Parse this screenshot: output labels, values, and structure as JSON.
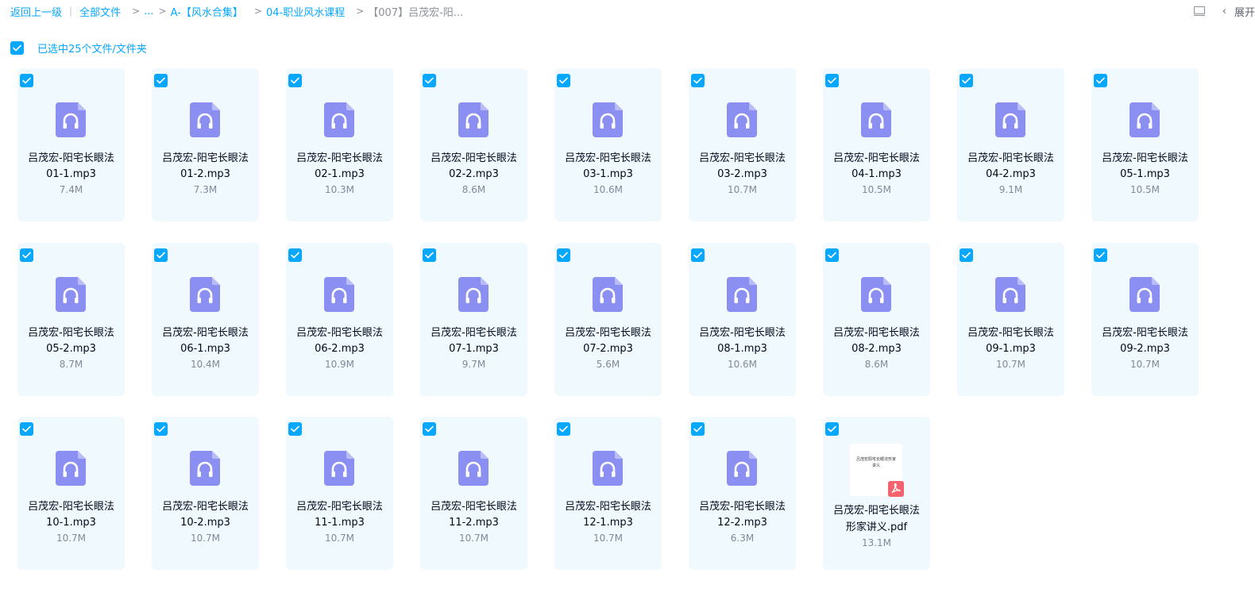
{
  "breadcrumb": {
    "back": "返回上一级",
    "all_files": "全部文件",
    "ellipsis": "...",
    "folder_a": "A-【风水合集】",
    "folder_04": "04-职业风水课程",
    "current": "【007】吕茂宏-阳..."
  },
  "top_right": {
    "expand_label": "展开"
  },
  "selection": {
    "label": "已选中25个文件/文件夹"
  },
  "colors": {
    "accent": "#06a7ff",
    "card_bg": "#f0f9fe",
    "audio_icon": "#8b8ff2",
    "pdf_badge": "#f5646e"
  },
  "files": [
    {
      "line1": "吕茂宏-阳宅长眼法",
      "line2": "01-1.mp3",
      "size": "7.4M",
      "type": "audio"
    },
    {
      "line1": "吕茂宏-阳宅长眼法",
      "line2": "01-2.mp3",
      "size": "7.3M",
      "type": "audio"
    },
    {
      "line1": "吕茂宏-阳宅长眼法",
      "line2": "02-1.mp3",
      "size": "10.3M",
      "type": "audio"
    },
    {
      "line1": "吕茂宏-阳宅长眼法",
      "line2": "02-2.mp3",
      "size": "8.6M",
      "type": "audio"
    },
    {
      "line1": "吕茂宏-阳宅长眼法",
      "line2": "03-1.mp3",
      "size": "10.6M",
      "type": "audio"
    },
    {
      "line1": "吕茂宏-阳宅长眼法",
      "line2": "03-2.mp3",
      "size": "10.7M",
      "type": "audio"
    },
    {
      "line1": "吕茂宏-阳宅长眼法",
      "line2": "04-1.mp3",
      "size": "10.5M",
      "type": "audio"
    },
    {
      "line1": "吕茂宏-阳宅长眼法",
      "line2": "04-2.mp3",
      "size": "9.1M",
      "type": "audio"
    },
    {
      "line1": "吕茂宏-阳宅长眼法",
      "line2": "05-1.mp3",
      "size": "10.5M",
      "type": "audio"
    },
    {
      "line1": "吕茂宏-阳宅长眼法",
      "line2": "05-2.mp3",
      "size": "8.7M",
      "type": "audio"
    },
    {
      "line1": "吕茂宏-阳宅长眼法",
      "line2": "06-1.mp3",
      "size": "10.4M",
      "type": "audio"
    },
    {
      "line1": "吕茂宏-阳宅长眼法",
      "line2": "06-2.mp3",
      "size": "10.9M",
      "type": "audio"
    },
    {
      "line1": "吕茂宏-阳宅长眼法",
      "line2": "07-1.mp3",
      "size": "9.7M",
      "type": "audio"
    },
    {
      "line1": "吕茂宏-阳宅长眼法",
      "line2": "07-2.mp3",
      "size": "5.6M",
      "type": "audio"
    },
    {
      "line1": "吕茂宏-阳宅长眼法",
      "line2": "08-1.mp3",
      "size": "10.6M",
      "type": "audio"
    },
    {
      "line1": "吕茂宏-阳宅长眼法",
      "line2": "08-2.mp3",
      "size": "8.6M",
      "type": "audio"
    },
    {
      "line1": "吕茂宏-阳宅长眼法",
      "line2": "09-1.mp3",
      "size": "10.7M",
      "type": "audio"
    },
    {
      "line1": "吕茂宏-阳宅长眼法",
      "line2": "09-2.mp3",
      "size": "10.7M",
      "type": "audio"
    },
    {
      "line1": "吕茂宏-阳宅长眼法",
      "line2": "10-1.mp3",
      "size": "10.7M",
      "type": "audio"
    },
    {
      "line1": "吕茂宏-阳宅长眼法",
      "line2": "10-2.mp3",
      "size": "10.7M",
      "type": "audio"
    },
    {
      "line1": "吕茂宏-阳宅长眼法",
      "line2": "11-1.mp3",
      "size": "10.7M",
      "type": "audio"
    },
    {
      "line1": "吕茂宏-阳宅长眼法",
      "line2": "11-2.mp3",
      "size": "10.7M",
      "type": "audio"
    },
    {
      "line1": "吕茂宏-阳宅长眼法",
      "line2": "12-1.mp3",
      "size": "10.7M",
      "type": "audio"
    },
    {
      "line1": "吕茂宏-阳宅长眼法",
      "line2": "12-2.mp3",
      "size": "6.3M",
      "type": "audio"
    },
    {
      "line1": "吕茂宏-阳宅长眼法",
      "line2": "形家讲义.pdf",
      "size": "13.1M",
      "type": "pdf",
      "thumb_text": "吕茂宏阳宅长眼法形家讲义"
    }
  ]
}
